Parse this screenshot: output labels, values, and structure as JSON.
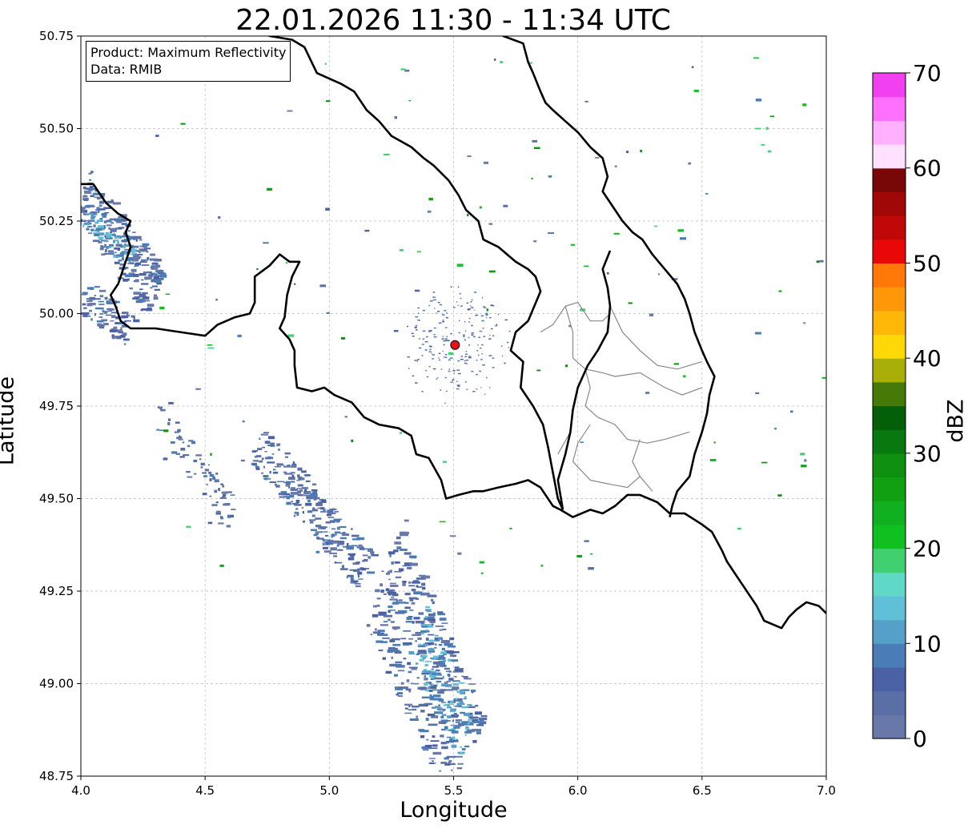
{
  "title": "22.01.2026 11:30 - 11:34 UTC",
  "info_box": {
    "product": "Product: Maximum Reflectivity",
    "data": "Data: RMIB"
  },
  "axes": {
    "xlabel": "Longitude",
    "ylabel": "Latitude",
    "xlim": [
      4.0,
      7.0
    ],
    "ylim": [
      48.75,
      50.75
    ],
    "xticks": [
      "4.0",
      "4.5",
      "5.0",
      "5.5",
      "6.0",
      "6.5",
      "7.0"
    ],
    "yticks": [
      "48.75",
      "49.00",
      "49.25",
      "49.50",
      "49.75",
      "50.00",
      "50.25",
      "50.50",
      "50.75"
    ],
    "grid": true
  },
  "colorbar": {
    "label": "dBZ",
    "range": [
      0,
      70
    ],
    "ticks": [
      "0",
      "10",
      "20",
      "30",
      "40",
      "50",
      "60",
      "70"
    ],
    "colors": [
      "#6878a8",
      "#5a6fa5",
      "#4a62a5",
      "#4a7db5",
      "#55a0c8",
      "#60c0d8",
      "#60d8c8",
      "#40d070",
      "#10c020",
      "#10b020",
      "#10a010",
      "#109010",
      "#087810",
      "#055e08",
      "#457a08",
      "#a8b008",
      "#ffd808",
      "#ffb808",
      "#ff9808",
      "#ff7808",
      "#e80808",
      "#c00808",
      "#a00808",
      "#780808",
      "#ffe0ff",
      "#ffb0ff",
      "#ff70ff",
      "#f040f0"
    ]
  },
  "radar_site": {
    "lon": 5.506,
    "lat": 49.915,
    "color": "#e8101a"
  },
  "colors": {
    "border": "#000000",
    "admin": "#888888",
    "grid": "#bbbbbb"
  }
}
